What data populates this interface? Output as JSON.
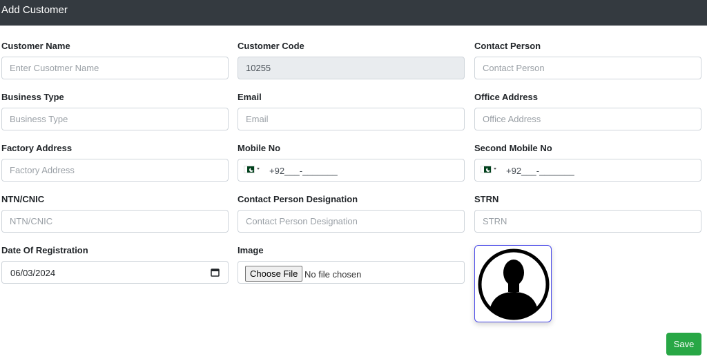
{
  "header": {
    "title": "Add Customer"
  },
  "fields": {
    "customer_name": {
      "label": "Customer Name",
      "placeholder": "Enter Cusotmer Name",
      "value": ""
    },
    "customer_code": {
      "label": "Customer Code",
      "value": "10255"
    },
    "contact_person": {
      "label": "Contact Person",
      "placeholder": "Contact Person",
      "value": ""
    },
    "business_type": {
      "label": "Business Type",
      "placeholder": "Business Type",
      "value": ""
    },
    "email": {
      "label": "Email",
      "placeholder": "Email",
      "value": ""
    },
    "office_address": {
      "label": "Office Address",
      "placeholder": "Office Address",
      "value": ""
    },
    "factory_address": {
      "label": "Factory Address",
      "placeholder": "Factory Address",
      "value": ""
    },
    "mobile_no": {
      "label": "Mobile No",
      "value": "+92___-_______"
    },
    "second_mobile_no": {
      "label": "Second Mobile No",
      "value": "+92___-_______"
    },
    "ntn_cnic": {
      "label": "NTN/CNIC",
      "placeholder": "NTN/CNIC",
      "value": ""
    },
    "contact_person_designation": {
      "label": "Contact Person Designation",
      "placeholder": "Contact Person Designation",
      "value": ""
    },
    "strn": {
      "label": "STRN",
      "placeholder": "STRN",
      "value": ""
    },
    "date_of_registration": {
      "label": "Date Of Registration",
      "value": "06/03/2024"
    },
    "image": {
      "label": "Image",
      "button_label": "Choose File",
      "status": "No file chosen"
    }
  },
  "phone_flag": {
    "icon": "pakistan-flag-icon",
    "colors": {
      "green": "#01411c",
      "white": "#ffffff"
    }
  },
  "avatar": {
    "icon": "user-silhouette-icon"
  },
  "actions": {
    "save_label": "Save"
  },
  "colors": {
    "header_bg": "#343a40",
    "save_bg": "#28a745",
    "readonly_bg": "#e9ecef",
    "avatar_border": "#4a4ae8"
  }
}
